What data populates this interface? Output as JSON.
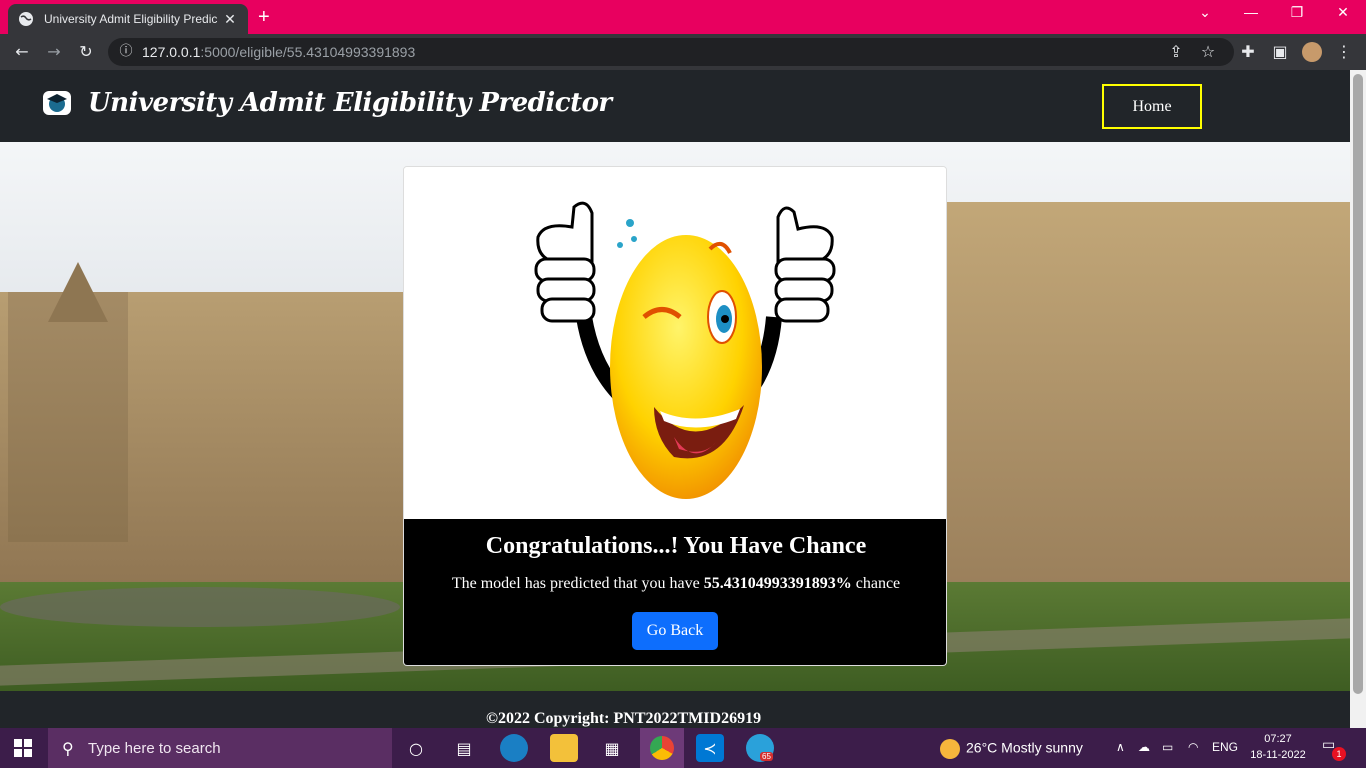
{
  "browser": {
    "tab_title": "University Admit Eligibility Predic",
    "tab_close": "✕",
    "new_tab": "+",
    "url_host": "127.0.0.1",
    "url_path": ":5000/eligible/55.43104993391893",
    "window_controls": {
      "minimize": "—",
      "restore": "❐",
      "close": "✕",
      "tab_search": "⌄"
    },
    "icons": {
      "back": "arrow-left-icon",
      "forward": "arrow-right-icon",
      "reload": "reload-icon",
      "info": "info-icon",
      "share": "share-icon",
      "star": "star-icon",
      "extensions": "puzzle-icon",
      "sidepanel": "sidepanel-icon",
      "profile": "avatar",
      "menu": "kebab-menu-icon"
    }
  },
  "navbar": {
    "brand": "University Admit Eligibility Predictor",
    "home": "Home",
    "accent": "#ffff00"
  },
  "result": {
    "title": "Congratulations...! You Have Chance",
    "text_before": "The model has predicted that you have ",
    "percent": "55.43104993391893%",
    "text_after": " chance",
    "button": "Go Back",
    "button_color": "#0d6efd"
  },
  "footer": {
    "copyright": "©2022 Copyright: PNT2022TMID26919"
  },
  "taskbar": {
    "search_placeholder": "Type here to search",
    "weather": "26°C  Mostly sunny",
    "language": "ENG",
    "time": "07:27",
    "date": "18-11-2022",
    "notifications": "1",
    "telegram_badge": "65",
    "accent": "#3c1d4a"
  }
}
